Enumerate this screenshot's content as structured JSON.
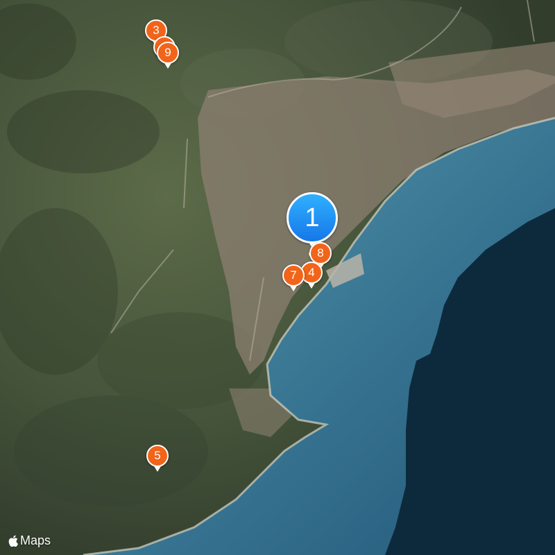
{
  "map": {
    "type": "satellite",
    "attribution": "Maps",
    "attribution_icon": "apple-logo-icon",
    "colors": {
      "sea_shallow": "#3f7c97",
      "sea_deep": "#0d2a3c",
      "land": "#4a5a3c",
      "urban": "#8c7f72",
      "pin_orange": "#f26419",
      "pin_blue": "#1f8ff0"
    }
  },
  "markers": [
    {
      "label": "1",
      "kind": "selected",
      "color": "#1f8ff0"
    },
    {
      "label": "3",
      "kind": "cluster",
      "color": "#f26419"
    },
    {
      "label": "9",
      "kind": "cluster",
      "color": "#f26419"
    },
    {
      "label": "8",
      "kind": "cluster",
      "color": "#f26419"
    },
    {
      "label": "4",
      "kind": "cluster",
      "color": "#f26419"
    },
    {
      "label": "7",
      "kind": "cluster",
      "color": "#f26419"
    },
    {
      "label": "5",
      "kind": "cluster",
      "color": "#f26419"
    }
  ]
}
